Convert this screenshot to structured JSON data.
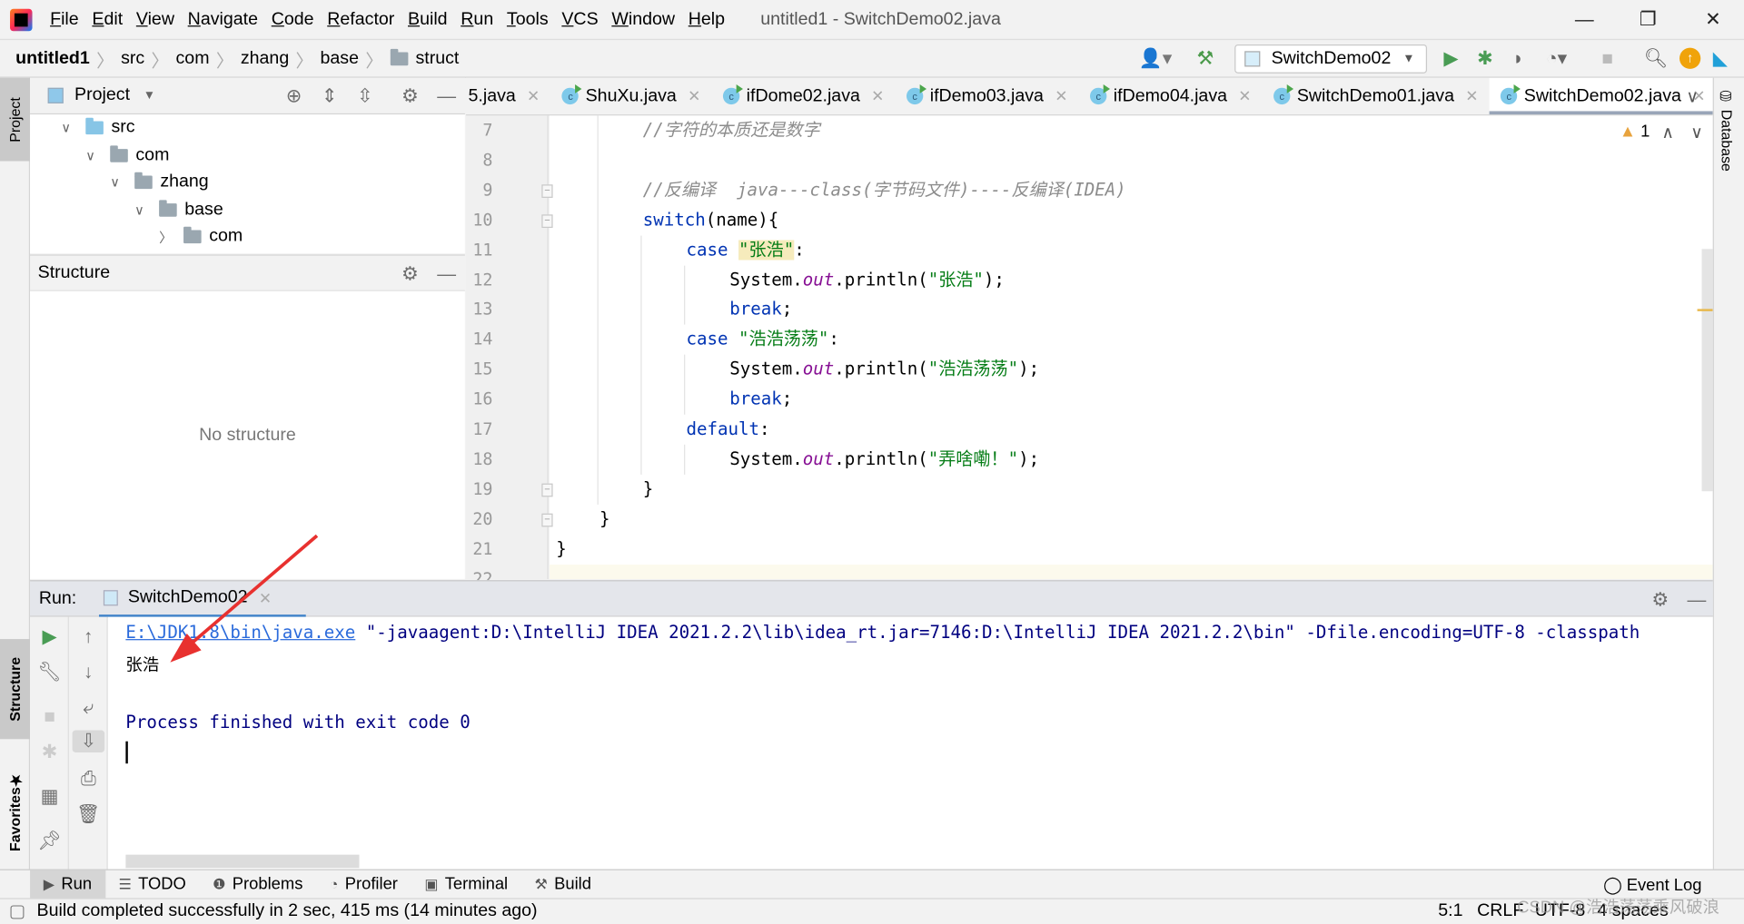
{
  "menu": {
    "items": [
      "File",
      "Edit",
      "View",
      "Navigate",
      "Code",
      "Refactor",
      "Build",
      "Run",
      "Tools",
      "VCS",
      "Window",
      "Help"
    ],
    "window_title": "untitled1 - SwitchDemo02.java"
  },
  "breadcrumb": [
    "untitled1",
    "src",
    "com",
    "zhang",
    "base",
    "struct"
  ],
  "toolbar": {
    "run_config": "SwitchDemo02"
  },
  "project_panel": {
    "title": "Project",
    "tree": [
      {
        "label": "src",
        "depth": 0,
        "expanded": true
      },
      {
        "label": "com",
        "depth": 1,
        "expanded": true
      },
      {
        "label": "zhang",
        "depth": 2,
        "expanded": true
      },
      {
        "label": "base",
        "depth": 3,
        "expanded": true
      },
      {
        "label": "com",
        "depth": 4,
        "expanded": false
      }
    ]
  },
  "structure_panel": {
    "title": "Structure",
    "empty_text": "No structure"
  },
  "left_strip": {
    "project": "Project",
    "structure": "Structure",
    "favorites": "Favorites"
  },
  "right_strip": {
    "database": "Database"
  },
  "editor": {
    "tabs": [
      {
        "label": "5.java"
      },
      {
        "label": "ShuXu.java"
      },
      {
        "label": "ifDome02.java"
      },
      {
        "label": "ifDemo03.java"
      },
      {
        "label": "ifDemo04.java"
      },
      {
        "label": "SwitchDemo01.java"
      },
      {
        "label": "SwitchDemo02.java",
        "active": true
      }
    ],
    "warnings": "1",
    "lines": [
      {
        "n": "7",
        "indent": 2,
        "tokens": [
          [
            "cmt",
            "//字符的本质还是数字"
          ]
        ]
      },
      {
        "n": "8",
        "indent": 0,
        "tokens": []
      },
      {
        "n": "9",
        "indent": 2,
        "tokens": [
          [
            "cmt",
            "//反编译  java---class(字节码文件)----反编译(IDEA)"
          ]
        ]
      },
      {
        "n": "10",
        "indent": 2,
        "tokens": [
          [
            "kw",
            "switch"
          ],
          [
            "",
            "(name){"
          ]
        ]
      },
      {
        "n": "11",
        "indent": 3,
        "tokens": [
          [
            "kw",
            "case "
          ],
          [
            "str hl",
            "\"张浩\""
          ],
          [
            "",
            ":"
          ]
        ]
      },
      {
        "n": "12",
        "indent": 4,
        "tokens": [
          [
            "",
            "System."
          ],
          [
            "fld",
            "out"
          ],
          [
            "",
            ".println("
          ],
          [
            "str",
            "\"张浩\""
          ],
          [
            "",
            ");"
          ]
        ]
      },
      {
        "n": "13",
        "indent": 4,
        "tokens": [
          [
            "kw",
            "break"
          ],
          [
            "",
            ";"
          ]
        ]
      },
      {
        "n": "14",
        "indent": 3,
        "tokens": [
          [
            "kw",
            "case "
          ],
          [
            "str",
            "\"浩浩荡荡\""
          ],
          [
            "",
            ":"
          ]
        ]
      },
      {
        "n": "15",
        "indent": 4,
        "tokens": [
          [
            "",
            "System."
          ],
          [
            "fld",
            "out"
          ],
          [
            "",
            ".println("
          ],
          [
            "str",
            "\"浩浩荡荡\""
          ],
          [
            "",
            ");"
          ]
        ]
      },
      {
        "n": "16",
        "indent": 4,
        "tokens": [
          [
            "kw",
            "break"
          ],
          [
            "",
            ";"
          ]
        ]
      },
      {
        "n": "17",
        "indent": 3,
        "tokens": [
          [
            "kw",
            "default"
          ],
          [
            "",
            ":"
          ]
        ]
      },
      {
        "n": "18",
        "indent": 4,
        "tokens": [
          [
            "",
            "System."
          ],
          [
            "fld",
            "out"
          ],
          [
            "",
            ".println("
          ],
          [
            "str",
            "\"弄啥嘞！\""
          ],
          [
            "",
            ");"
          ]
        ]
      },
      {
        "n": "19",
        "indent": 2,
        "tokens": [
          [
            "",
            "}"
          ]
        ]
      },
      {
        "n": "20",
        "indent": 1,
        "tokens": [
          [
            "",
            "}"
          ]
        ]
      },
      {
        "n": "21",
        "indent": 0,
        "tokens": [
          [
            "",
            "}"
          ]
        ]
      },
      {
        "n": "22",
        "indent": 0,
        "tokens": []
      }
    ]
  },
  "run_panel": {
    "label": "Run:",
    "tab": "SwitchDemo02",
    "cmd_link": "E:\\JDK1.8\\bin\\java.exe",
    "cmd_rest": " \"-javaagent:D:\\IntelliJ IDEA 2021.2.2\\lib\\idea_rt.jar=7146:D:\\IntelliJ IDEA 2021.2.2\\bin\" -Dfile.encoding=UTF-8 -classpath",
    "output": "张浩",
    "exit": "Process finished with exit code 0"
  },
  "bottom_tabs": [
    {
      "label": "Run",
      "icon": "play-icon",
      "active": true
    },
    {
      "label": "TODO",
      "icon": "list-icon"
    },
    {
      "label": "Problems",
      "icon": "problems-icon"
    },
    {
      "label": "Profiler",
      "icon": "profiler-icon"
    },
    {
      "label": "Terminal",
      "icon": "terminal-icon"
    },
    {
      "label": "Build",
      "icon": "hammer-icon"
    }
  ],
  "event_log": "Event Log",
  "status": {
    "message": "Build completed successfully in 2 sec, 415 ms (14 minutes ago)",
    "position": "5:1",
    "line_sep": "CRLF",
    "encoding": "UTF-8",
    "indent": "4 spaces"
  },
  "watermark": "CSDN @浩浩荡荡乘风破浪",
  "colors": {
    "keyword": "#0033b3",
    "string": "#067d17",
    "comment": "#8c8c8c",
    "field": "#871094",
    "console": "#000080",
    "link": "#2a6adb",
    "annotation_arrow": "#e8312f"
  }
}
